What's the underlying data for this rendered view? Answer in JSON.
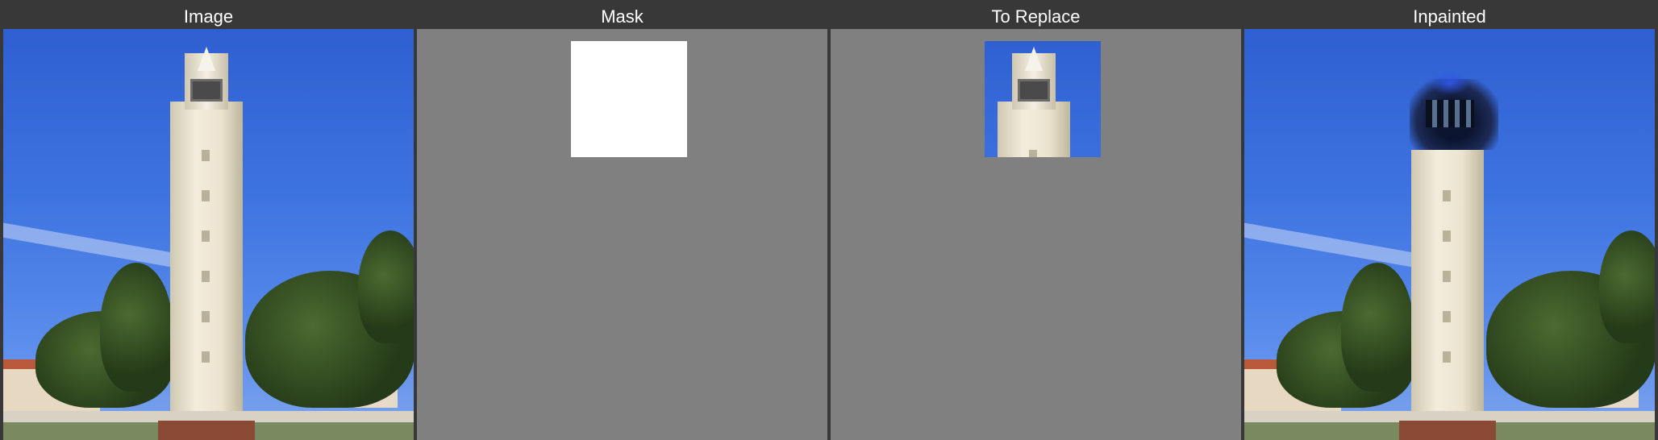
{
  "panels": [
    {
      "title": "Image",
      "kind": "photo"
    },
    {
      "title": "Mask",
      "kind": "mask"
    },
    {
      "title": "To Replace",
      "kind": "crop"
    },
    {
      "title": "Inpainted",
      "kind": "inpainted"
    }
  ],
  "colors": {
    "window_bg": "#383838",
    "panel_bg": "#808080",
    "mask_fill": "#ffffff",
    "title_text": "#ffffff"
  }
}
